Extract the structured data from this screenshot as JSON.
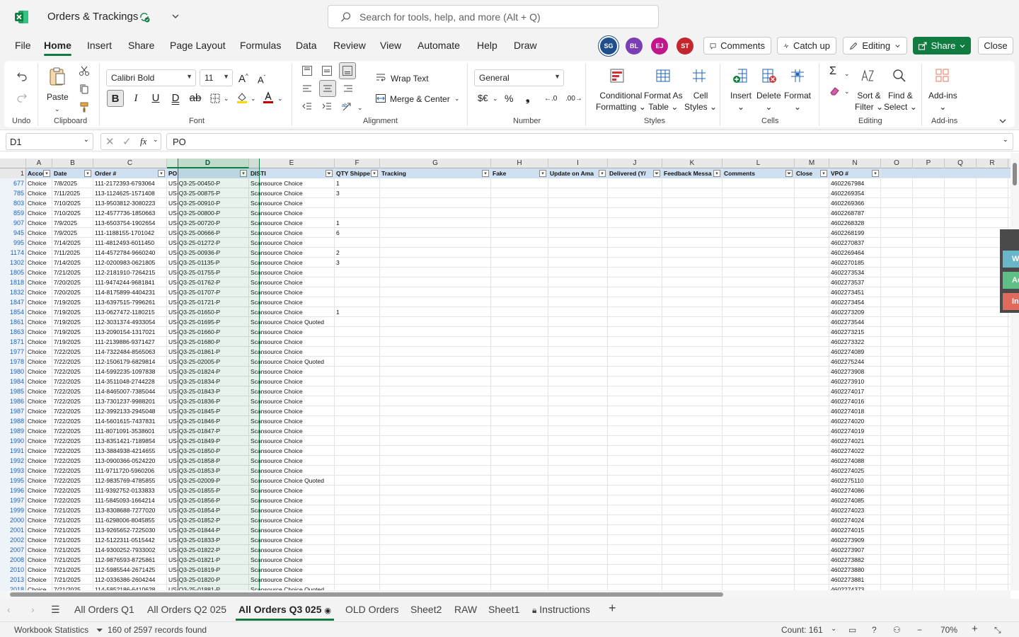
{
  "app": {
    "doc_title": "Orders & Trackings",
    "search_placeholder": "Search for tools, help, and more (Alt + Q)"
  },
  "menu": [
    "File",
    "Home",
    "Insert",
    "Share",
    "Page Layout",
    "Formulas",
    "Data",
    "Review",
    "View",
    "Automate",
    "Help",
    "Draw"
  ],
  "menu_active": "Home",
  "avatars": [
    {
      "initials": "SG",
      "color": "#1f4e8c"
    },
    {
      "initials": "BL",
      "color": "#7a3fb5"
    },
    {
      "initials": "EJ",
      "color": "#c0188b"
    },
    {
      "initials": "ST",
      "color": "#c4262e"
    }
  ],
  "header_buttons": {
    "comments": "Comments",
    "catchup": "Catch up",
    "editing": "Editing",
    "share": "Share",
    "close": "Close"
  },
  "ribbon": {
    "groups": {
      "undo": "Undo",
      "clipboard": "Clipboard",
      "font": "Font",
      "alignment": "Alignment",
      "number": "Number",
      "styles": "Styles",
      "cells": "Cells",
      "editing": "Editing",
      "addins": "Add-ins"
    },
    "paste": "Paste",
    "font_name": "Calibri Bold",
    "font_size": "11",
    "wrap_text": "Wrap Text",
    "merge_center": "Merge & Center",
    "number_format": "General",
    "conditional_formatting": [
      "Conditional",
      "Formatting"
    ],
    "format_as_table": [
      "Format As",
      "Table"
    ],
    "cell_styles": [
      "Cell",
      "Styles"
    ],
    "insert": "Insert",
    "delete": "Delete",
    "format": "Format",
    "sort_filter": [
      "Sort &",
      "Filter"
    ],
    "find_select": [
      "Find &",
      "Select"
    ],
    "addins_btn": "Add-ins"
  },
  "formula_bar": {
    "name_box": "D1",
    "formula": "PO"
  },
  "columns": [
    "A",
    "B",
    "C",
    "D",
    "E",
    "F",
    "G",
    "H",
    "I",
    "J",
    "K",
    "L",
    "M",
    "N",
    "O",
    "P",
    "Q",
    "R"
  ],
  "selected_column": "D",
  "header_row": {
    "num": "1",
    "cells": [
      "Accou",
      "Date",
      "Order #",
      "PO",
      "DISTI",
      "QTY Shippe",
      "Tracking",
      "Fake",
      "Update on Ama",
      "Delivered (Y/",
      "Feedback Messa",
      "Comments",
      "Close",
      "VPO #"
    ]
  },
  "rows": [
    [
      "677",
      "Choice",
      "7/8/2025",
      "111-2172393-6793064",
      "US-Q3-25-00450-P",
      "Scansource Choice",
      "1",
      "4602267984"
    ],
    [
      "785",
      "Choice",
      "7/11/2025",
      "113-1124625-1571408",
      "US-Q3-25-00875-P",
      "Scansource Choice",
      "3",
      "4602269354"
    ],
    [
      "803",
      "Choice",
      "7/10/2025",
      "113-9503812-3080223",
      "US-Q3-25-00910-P",
      "Scansource Choice",
      "",
      "4602269366"
    ],
    [
      "859",
      "Choice",
      "7/10/2025",
      "112-4577736-1850663",
      "US-Q3-25-00800-P",
      "Scansource Choice",
      "",
      "4602268787"
    ],
    [
      "907",
      "Choice",
      "7/9/2025",
      "113-6503754-1902654",
      "US-Q3-25-00720-P",
      "Scansource Choice",
      "1",
      "4602268328"
    ],
    [
      "945",
      "Choice",
      "7/9/2025",
      "111-1188155-1701042",
      "US-Q3-25-00666-P",
      "Scansource Choice",
      "6",
      "4602268199"
    ],
    [
      "995",
      "Choice",
      "7/14/2025",
      "111-4812493-6011450",
      "US-Q3-25-01272-P",
      "Scansource Choice",
      "",
      "4602270837"
    ],
    [
      "1174",
      "Choice",
      "7/11/2025",
      "114-4572784-9660240",
      "US-Q3-25-00936-P",
      "Scansource Choice",
      "2",
      "4602269464"
    ],
    [
      "1302",
      "Choice",
      "7/14/2025",
      "112-0200983-0621805",
      "US-Q3-25-01135-P",
      "Scansource Choice",
      "3",
      "4602270185"
    ],
    [
      "1805",
      "Choice",
      "7/21/2025",
      "112-2181910-7264215",
      "US-Q3-25-01755-P",
      "Scansource Choice",
      "",
      "4602273534"
    ],
    [
      "1818",
      "Choice",
      "7/20/2025",
      "111-9474244-9681841",
      "US-Q3-25-01762-P",
      "Scansource Choice",
      "",
      "4602273537"
    ],
    [
      "1832",
      "Choice",
      "7/20/2025",
      "114-8175899-4404231",
      "US-Q3-25-01707-P",
      "Scansource Choice",
      "",
      "4602273451"
    ],
    [
      "1847",
      "Choice",
      "7/19/2025",
      "113-6397515-7996261",
      "US-Q3-25-01721-P",
      "Scansource Choice",
      "",
      "4602273454"
    ],
    [
      "1854",
      "Choice",
      "7/19/2025",
      "113-0627472-1180215",
      "US-Q3-25-01650-P",
      "Scansource Choice",
      "1",
      "4602273209"
    ],
    [
      "1861",
      "Choice",
      "7/19/2025",
      "112-3031374-4933054",
      "US-Q3-25-01695-P",
      "Scansource Choice Quoted",
      "",
      "4602273544"
    ],
    [
      "1863",
      "Choice",
      "7/19/2025",
      "113-2090154-1317021",
      "US-Q3-25-01660-P",
      "Scansource Choice",
      "",
      "4602273215"
    ],
    [
      "1871",
      "Choice",
      "7/19/2025",
      "111-2139886-9371427",
      "US-Q3-25-01680-P",
      "Scansource Choice",
      "",
      "4602273322"
    ],
    [
      "1977",
      "Choice",
      "7/22/2025",
      "114-7322484-8565063",
      "US-Q3-25-01861-P",
      "Scansource Choice",
      "",
      "4602274089"
    ],
    [
      "1978",
      "Choice",
      "7/22/2025",
      "112-1506179-6829814",
      "US-Q3-25-02005-P",
      "Scansource Choice Quoted",
      "",
      "4602275244"
    ],
    [
      "1980",
      "Choice",
      "7/22/2025",
      "114-5992235-1097838",
      "US-Q3-25-01824-P",
      "Scansource Choice",
      "",
      "4602273908"
    ],
    [
      "1984",
      "Choice",
      "7/22/2025",
      "114-3511048-2744228",
      "US-Q3-25-01834-P",
      "Scansource Choice",
      "",
      "4602273910"
    ],
    [
      "1985",
      "Choice",
      "7/22/2025",
      "114-8465007-7385044",
      "US-Q3-25-01843-P",
      "Scansource Choice",
      "",
      "4602274017"
    ],
    [
      "1986",
      "Choice",
      "7/22/2025",
      "113-7301237-9988201",
      "US-Q3-25-01836-P",
      "Scansource Choice",
      "",
      "4602274016"
    ],
    [
      "1987",
      "Choice",
      "7/22/2025",
      "112-3992133-2945048",
      "US-Q3-25-01845-P",
      "Scansource Choice",
      "",
      "4602274018"
    ],
    [
      "1988",
      "Choice",
      "7/22/2025",
      "114-5601615-7437831",
      "US-Q3-25-01846-P",
      "Scansource Choice",
      "",
      "4602274020"
    ],
    [
      "1989",
      "Choice",
      "7/22/2025",
      "111-8071091-3538601",
      "US-Q3-25-01847-P",
      "Scansource Choice",
      "",
      "4602274019"
    ],
    [
      "1990",
      "Choice",
      "7/22/2025",
      "113-8351421-7189854",
      "US-Q3-25-01849-P",
      "Scansource Choice",
      "",
      "4602274021"
    ],
    [
      "1991",
      "Choice",
      "7/22/2025",
      "113-3884938-4214655",
      "US-Q3-25-01850-P",
      "Scansource Choice",
      "",
      "4602274022"
    ],
    [
      "1992",
      "Choice",
      "7/22/2025",
      "113-0900366-0524220",
      "US-Q3-25-01858-P",
      "Scansource Choice",
      "",
      "4602274088"
    ],
    [
      "1993",
      "Choice",
      "7/22/2025",
      "111-9711720-5960206",
      "US-Q3-25-01853-P",
      "Scansource Choice",
      "",
      "4602274025"
    ],
    [
      "1995",
      "Choice",
      "7/22/2025",
      "112-9835769-4785855",
      "US-Q3-25-02009-P",
      "Scansource Choice Quoted",
      "",
      "4602275110"
    ],
    [
      "1996",
      "Choice",
      "7/22/2025",
      "111-9392752-0133833",
      "US-Q3-25-01855-P",
      "Scansource Choice",
      "",
      "4602274086"
    ],
    [
      "1997",
      "Choice",
      "7/22/2025",
      "111-5845093-1664214",
      "US-Q3-25-01856-P",
      "Scansource Choice",
      "",
      "4602274085"
    ],
    [
      "1999",
      "Choice",
      "7/21/2025",
      "113-8308688-7277020",
      "US-Q3-25-01854-P",
      "Scansource Choice",
      "",
      "4602274023"
    ],
    [
      "2000",
      "Choice",
      "7/21/2025",
      "111-6298006-8045855",
      "US-Q3-25-01852-P",
      "Scansource Choice",
      "",
      "4602274024"
    ],
    [
      "2001",
      "Choice",
      "7/21/2025",
      "113-9265652-7225030",
      "US-Q3-25-01844-P",
      "Scansource Choice",
      "",
      "4602274015"
    ],
    [
      "2002",
      "Choice",
      "7/21/2025",
      "112-5122311-0515442",
      "US-Q3-25-01833-P",
      "Scansource Choice",
      "",
      "4602273909"
    ],
    [
      "2007",
      "Choice",
      "7/21/2025",
      "114-9300252-7933002",
      "US-Q3-25-01822-P",
      "Scansource Choice",
      "",
      "4602273907"
    ],
    [
      "2008",
      "Choice",
      "7/21/2025",
      "112-9876593-8725861",
      "US-Q3-25-01821-P",
      "Scansource Choice",
      "",
      "4602273882"
    ],
    [
      "2010",
      "Choice",
      "7/21/2025",
      "112-5985544-2671425",
      "US-Q3-25-01819-P",
      "Scansource Choice",
      "",
      "4602273880"
    ],
    [
      "2013",
      "Choice",
      "7/21/2025",
      "112-0336386-2604244",
      "US-Q3-25-01820-P",
      "Scansource Choice",
      "",
      "4602273881"
    ],
    [
      "2018",
      "Choice",
      "7/21/2025",
      "114-5852186-6410628",
      "US-Q3-25-01881-P",
      "Scansource Choice Quoted",
      "",
      "4602274373"
    ]
  ],
  "side_panel": [
    "W",
    "Ac",
    "In"
  ],
  "sheet_tabs": [
    "All Orders Q1",
    "All Orders Q2 025",
    "All Orders Q3 025",
    "OLD Orders",
    "Sheet2",
    "RAW",
    "Sheet1",
    "Instructions"
  ],
  "active_sheet": "All Orders Q3 025",
  "status": {
    "workbook_stats": "Workbook Statistics",
    "records": "160 of 2597 records found",
    "count": "Count: 161",
    "zoom": "70%"
  },
  "colors": {
    "accent": "#107c41",
    "header_fill": "#cfe0f1",
    "row_number": "#1d63b8"
  }
}
